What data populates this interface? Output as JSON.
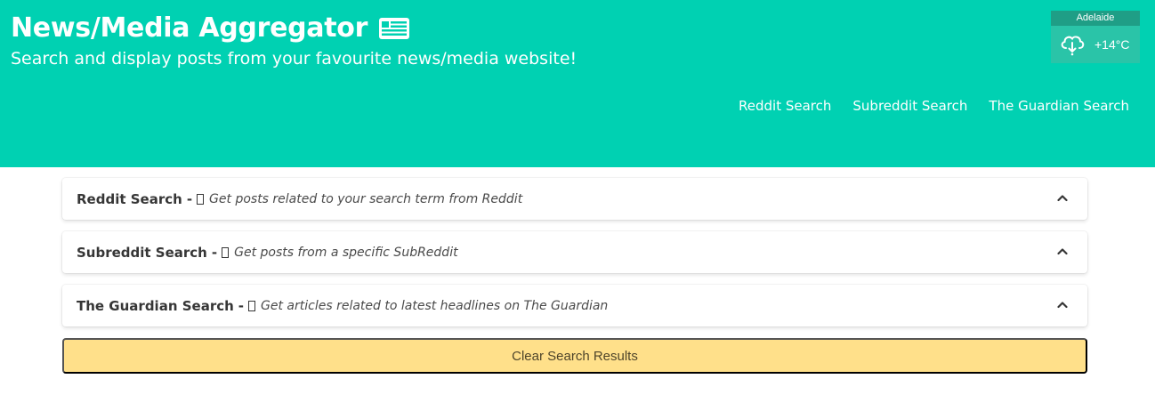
{
  "header": {
    "title": "News/Media Aggregator",
    "title_icon": "newspaper-icon",
    "subtitle": "Search and display posts from your favourite news/media website!"
  },
  "weather": {
    "city": "Adelaide",
    "icon": "cloud-rain-icon",
    "temperature": "+14°C"
  },
  "nav": {
    "items": [
      {
        "label": "Reddit Search"
      },
      {
        "label": "Subreddit Search"
      },
      {
        "label": "The Guardian Search"
      }
    ]
  },
  "cards": [
    {
      "title": "Reddit Search",
      "separator": "-",
      "description": "Get posts related to your search term from Reddit"
    },
    {
      "title": "Subreddit Search",
      "separator": "-",
      "description": "Get posts from a specific SubReddit"
    },
    {
      "title": "The Guardian Search",
      "separator": "-",
      "description": "Get articles related to latest headlines on The Guardian"
    }
  ],
  "clear_button": {
    "label": "Clear Search Results"
  },
  "colors": {
    "primary": "#00d1b2",
    "warning": "#ffe08a",
    "text": "#363636"
  }
}
